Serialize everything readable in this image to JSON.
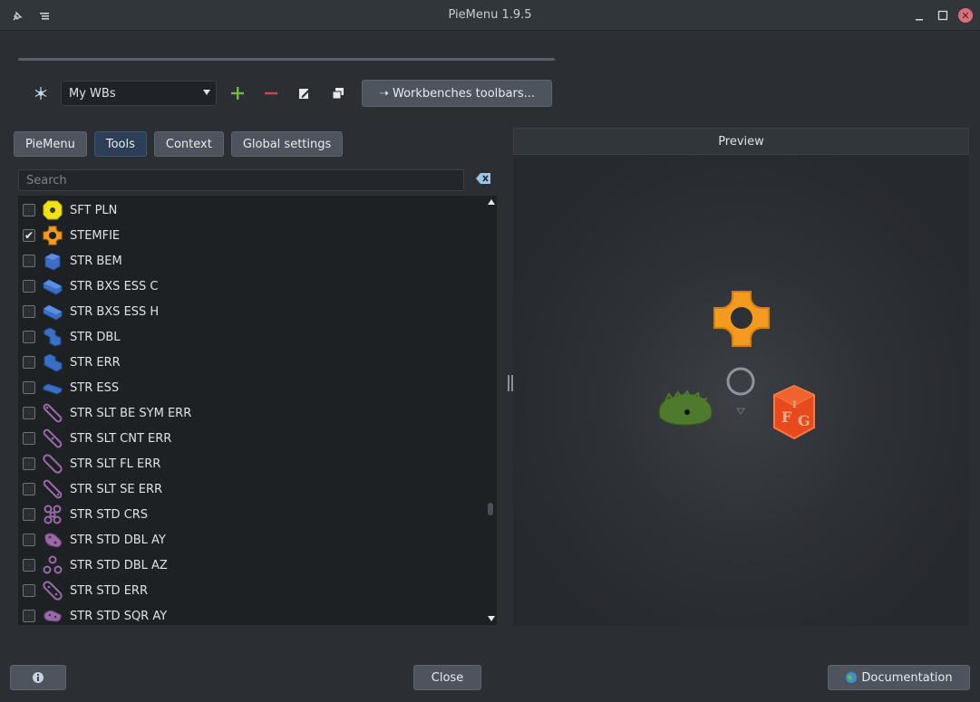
{
  "window": {
    "title": "PieMenu 1.9.5"
  },
  "toolbar": {
    "workbench_selected": "My WBs",
    "workbenches_button": "➝ Workbenches toolbars..."
  },
  "tabs": [
    "PieMenu",
    "Tools",
    "Context",
    "Global settings"
  ],
  "active_tab": "Tools",
  "search": {
    "placeholder": "Search"
  },
  "tools": [
    {
      "label": "SFT PLN",
      "checked": false,
      "icon": "yellow-nut-icon"
    },
    {
      "label": "STEMFIE",
      "checked": true,
      "icon": "stemfie-icon"
    },
    {
      "label": "STR BEM",
      "checked": false,
      "icon": "blue-brick-icon"
    },
    {
      "label": "STR BXS ESS C",
      "checked": false,
      "icon": "blue-brick-icon"
    },
    {
      "label": "STR BXS ESS H",
      "checked": false,
      "icon": "blue-brick-icon"
    },
    {
      "label": "STR DBL",
      "checked": false,
      "icon": "blue-brick-icon"
    },
    {
      "label": "STR ERR",
      "checked": false,
      "icon": "blue-brick-icon"
    },
    {
      "label": "STR ESS",
      "checked": false,
      "icon": "blue-brick-icon"
    },
    {
      "label": "STR SLT BE SYM ERR",
      "checked": false,
      "icon": "purple-link-icon"
    },
    {
      "label": "STR SLT CNT ERR",
      "checked": false,
      "icon": "purple-link-icon"
    },
    {
      "label": "STR SLT FL ERR",
      "checked": false,
      "icon": "purple-link-icon"
    },
    {
      "label": "STR SLT SE ERR",
      "checked": false,
      "icon": "purple-link-icon"
    },
    {
      "label": "STR STD CRS",
      "checked": false,
      "icon": "purple-cross-icon"
    },
    {
      "label": "STR STD DBL AY",
      "checked": false,
      "icon": "purple-plate-icon"
    },
    {
      "label": "STR STD DBL AZ",
      "checked": false,
      "icon": "purple-triangle-icon"
    },
    {
      "label": "STR STD ERR",
      "checked": false,
      "icon": "purple-link-icon"
    },
    {
      "label": "STR STD SQR AY",
      "checked": false,
      "icon": "purple-plate-icon"
    }
  ],
  "preview": {
    "header": "Preview"
  },
  "footer": {
    "close_label": "Close",
    "documentation_label": "Documentation"
  },
  "colors": {
    "accent_orange": "#f39a1f",
    "blue_icon": "#3a6fc4",
    "purple_icon": "#9a6aa8",
    "active_tab": "#2c3f57"
  }
}
